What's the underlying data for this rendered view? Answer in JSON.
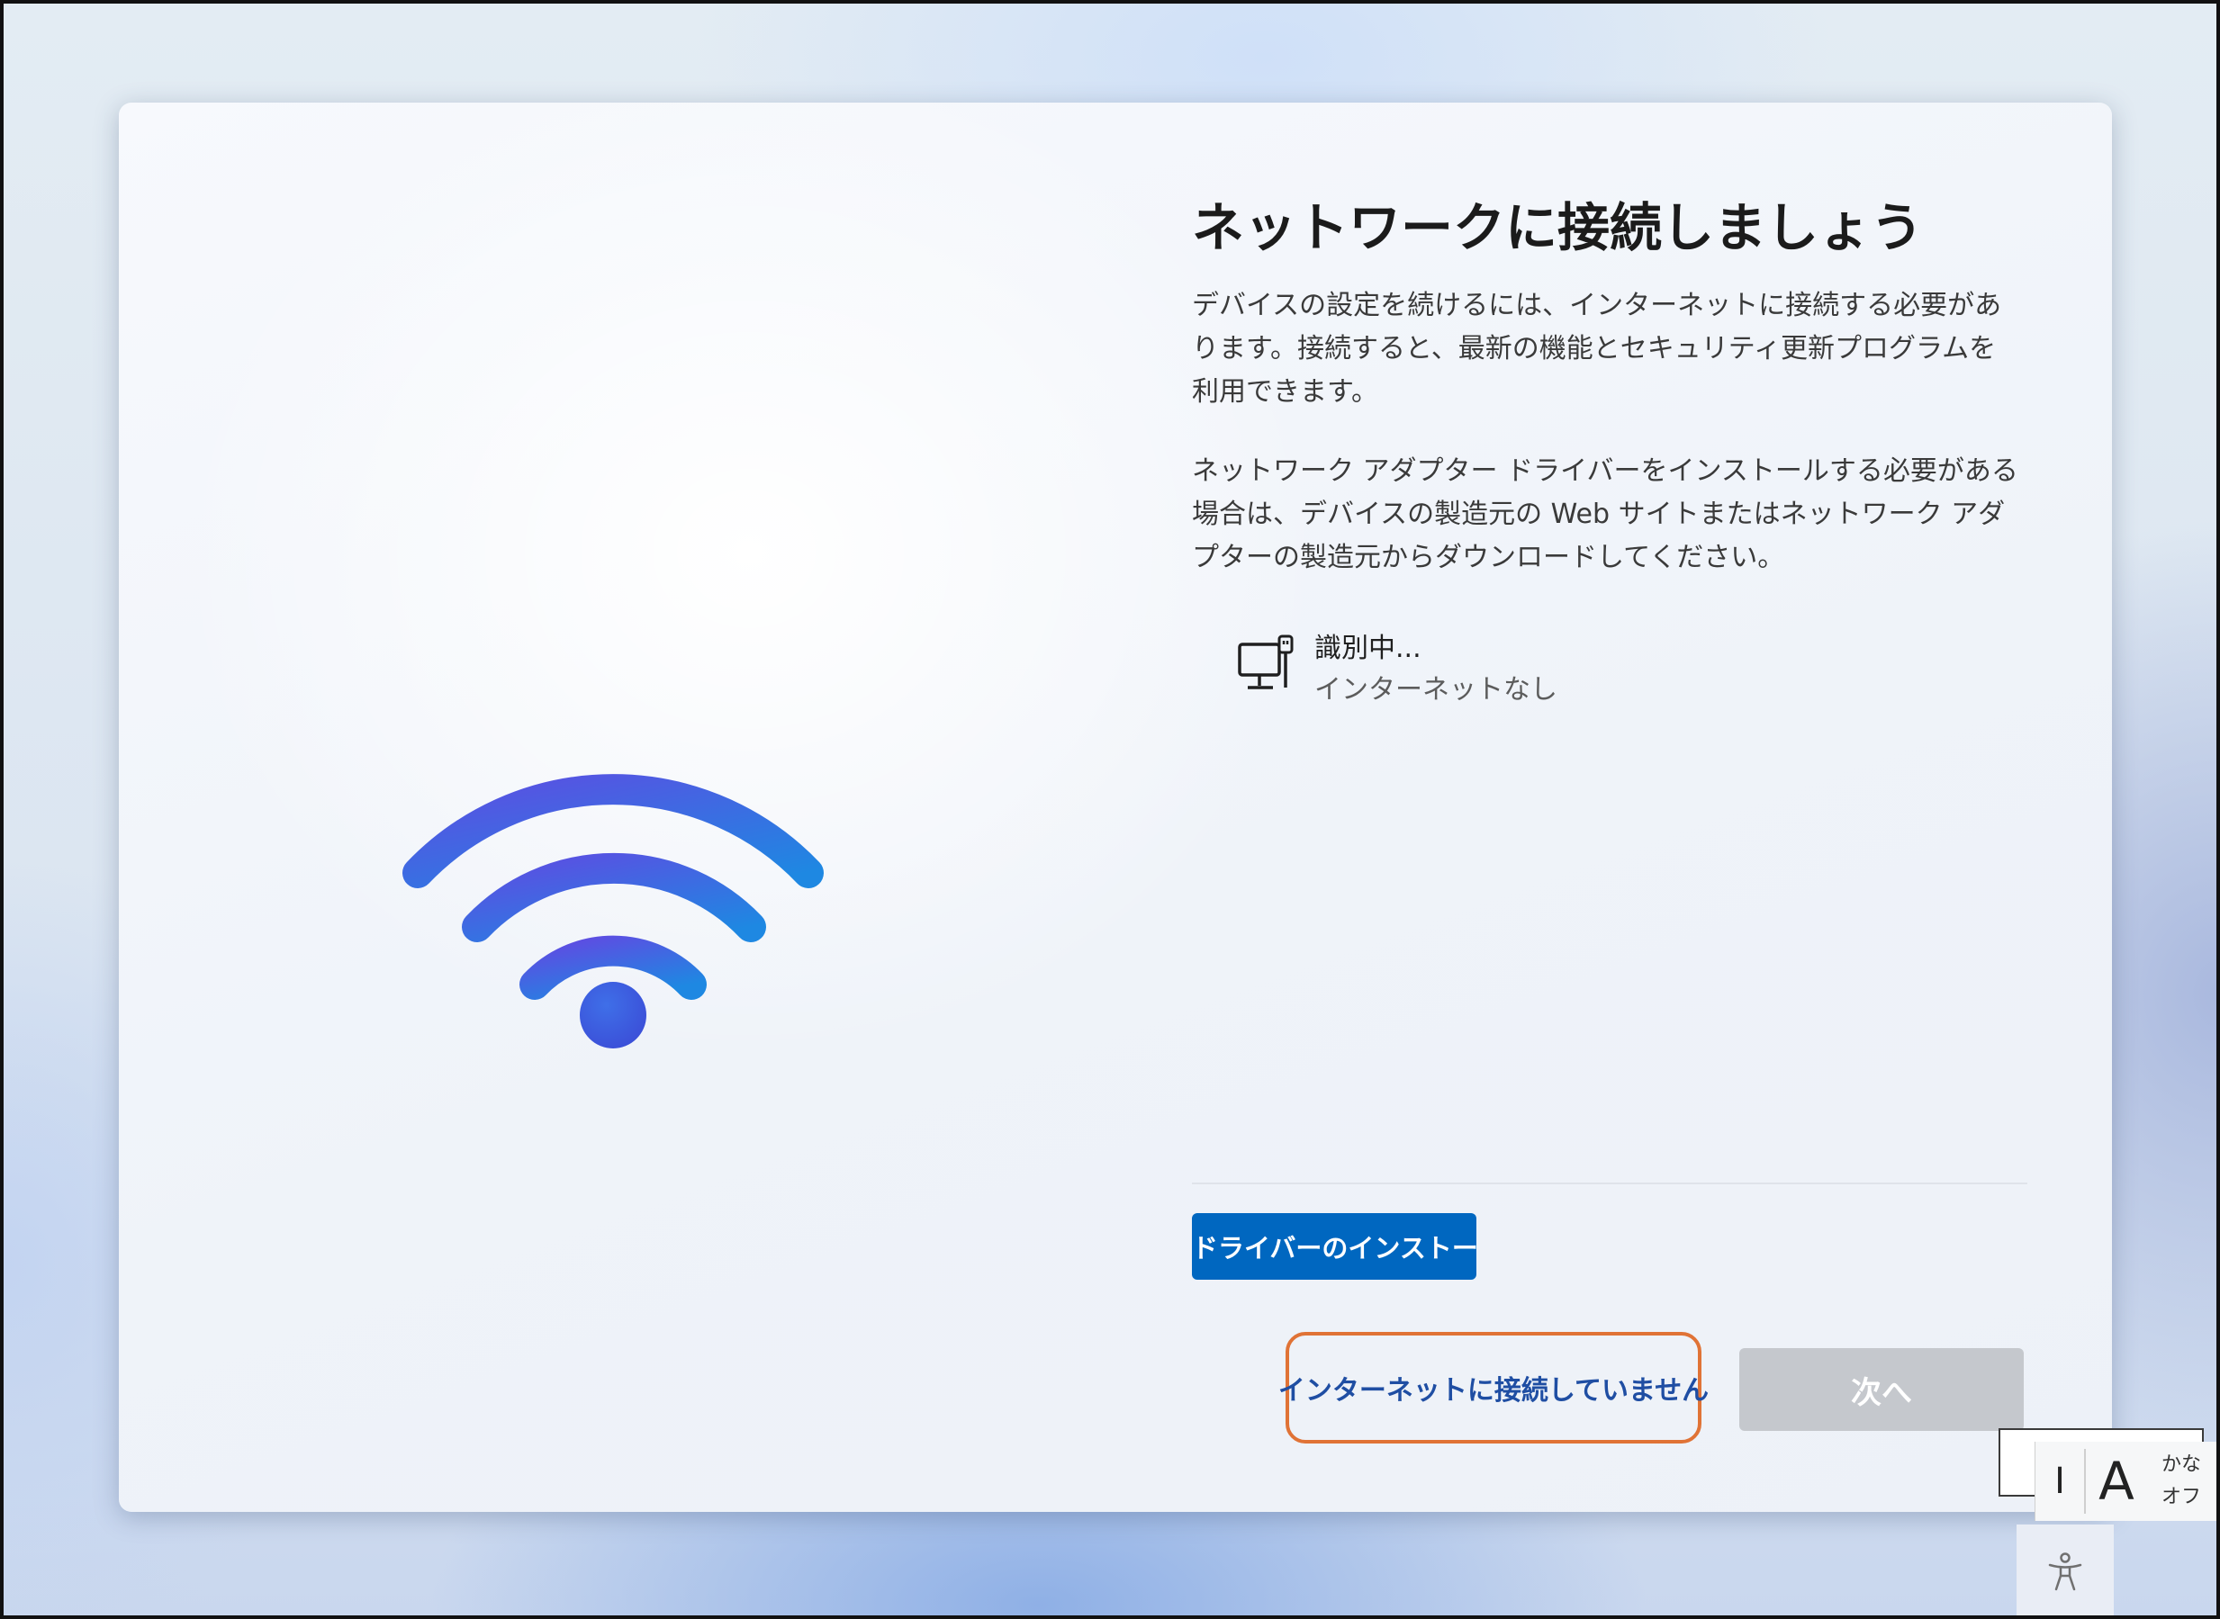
{
  "page": {
    "title": "ネットワークに接続しましょう",
    "description_1": "デバイスの設定を続けるには、インターネットに接続する必要があります。接続すると、最新の機能とセキュリティ更新プログラムを利用できます。",
    "description_2": "ネットワーク アダプター ドライバーをインストールする必要がある場合は、デバイスの製造元の Web サイトまたはネットワーク アダプターの製造元からダウンロードしてください。"
  },
  "network": {
    "name": "識別中...",
    "status": "インターネットなし",
    "icon": "wired-network-icon"
  },
  "buttons": {
    "install_driver": "ドライバーのインストー",
    "no_internet": "インターネットに接続していません",
    "next": "次へ"
  },
  "ime": {
    "cursor_glyph": "I",
    "mode": "A",
    "kana_line1": "かな",
    "kana_line2": "オフ"
  },
  "colors": {
    "primary_button": "#0067c0",
    "highlight_outline": "#e07336",
    "link_text": "#1f4ea3",
    "disabled_button": "#c5c8cd",
    "wifi_gradient_start": "#5a4fe0",
    "wifi_gradient_end": "#1f86e0"
  }
}
